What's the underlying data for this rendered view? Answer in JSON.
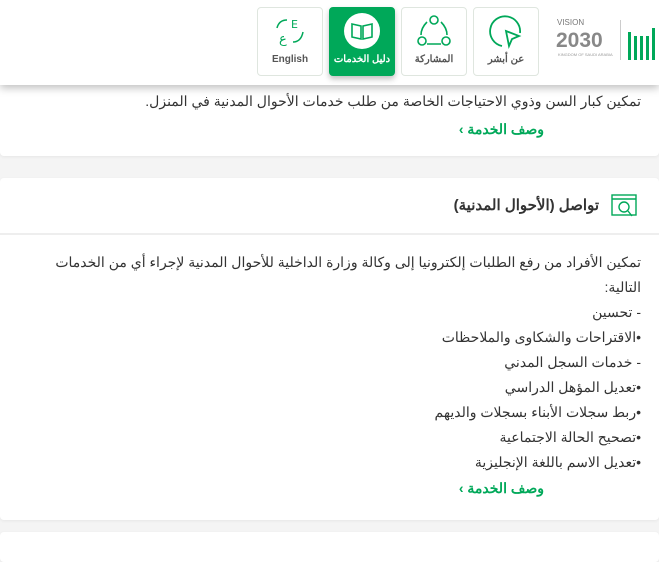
{
  "header": {
    "nav": [
      {
        "label": "English",
        "icon": "language-icon",
        "active": false
      },
      {
        "label": "دليل الخدمات",
        "icon": "book-icon",
        "active": true
      },
      {
        "label": "المشاركة",
        "icon": "share-icon",
        "active": false
      },
      {
        "label": "عن أبشر",
        "icon": "play-icon",
        "active": false
      }
    ],
    "vision_logo": "VISION 2030 رؤية المملكة العربية السعودية KINGDOM OF SAUDI ARABIA",
    "absher_logo": "أبشر"
  },
  "colors": {
    "accent": "#00a859"
  },
  "card1": {
    "description": "تمكين كبار السن وذوي الاحتياجات الخاصة من طلب خدمات الأحوال المدنية في المنزل.",
    "link": "وصف الخدمة ›"
  },
  "card2": {
    "title": "تواصل (الأحوال المدنية)",
    "icon": "monitor-search-icon",
    "lines": [
      "تمكين الأفراد من رفع الطلبات إلكترونيا إلى وكالة وزارة الداخلية للأحوال المدنية لإجراء أي من الخدمات التالية:",
      "- تحسين",
      "•الاقتراحات والشكاوى والملاحظات",
      "- خدمات السجل المدني",
      "•تعديل المؤهل الدراسي",
      "•ربط سجلات الأبناء بسجلات والديهم",
      "•تصحيح الحالة الاجتماعية",
      "•تعديل الاسم باللغة الإنجليزية"
    ],
    "link": "وصف الخدمة ›"
  }
}
